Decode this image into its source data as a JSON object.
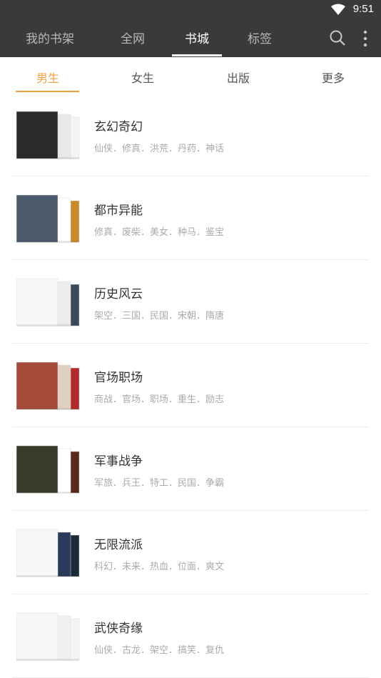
{
  "status": {
    "time": "9:51"
  },
  "nav": {
    "tabs": [
      "我的书架",
      "全网",
      "书城",
      "标签"
    ],
    "active": "书城"
  },
  "subtabs": {
    "tabs": [
      "男生",
      "女生",
      "出版",
      "更多"
    ],
    "active": "男生"
  },
  "categories": [
    {
      "title": "玄幻奇幻",
      "tags": "仙侠．修真．洪荒．丹药．神话",
      "cover_colors": [
        "#2a2a2a",
        "#e8e8e8",
        "#f4f4f4"
      ]
    },
    {
      "title": "都市异能",
      "tags": "修真．废柴．美女．种马．鉴宝",
      "cover_colors": [
        "#4a5a6a",
        "#ffffff",
        "#c98a2a"
      ]
    },
    {
      "title": "历史风云",
      "tags": "架空．三国．民国．宋朝．隋唐",
      "cover_colors": [
        "#f7f7f7",
        "#ececec",
        "#3a4a5a"
      ]
    },
    {
      "title": "官场职场",
      "tags": "商战．官场．职场．重生．励志",
      "cover_colors": [
        "#a34a3a",
        "#e0d0c0",
        "#b22a2a"
      ]
    },
    {
      "title": "军事战争",
      "tags": "军旅．兵王．特工．民国．争霸",
      "cover_colors": [
        "#3a3a2a",
        "#ffffff",
        "#5a2a1a"
      ]
    },
    {
      "title": "无限流派",
      "tags": "科幻．未来．热血．位面．爽文",
      "cover_colors": [
        "#f7f7f7",
        "#2a3a5a",
        "#1a2a3a"
      ]
    },
    {
      "title": "武侠奇缘",
      "tags": "仙侠．古龙．架空．搞笑．复仇",
      "cover_colors": [
        "#f7f7f7",
        "#f0f0f0",
        "#f4f4f4"
      ]
    }
  ]
}
